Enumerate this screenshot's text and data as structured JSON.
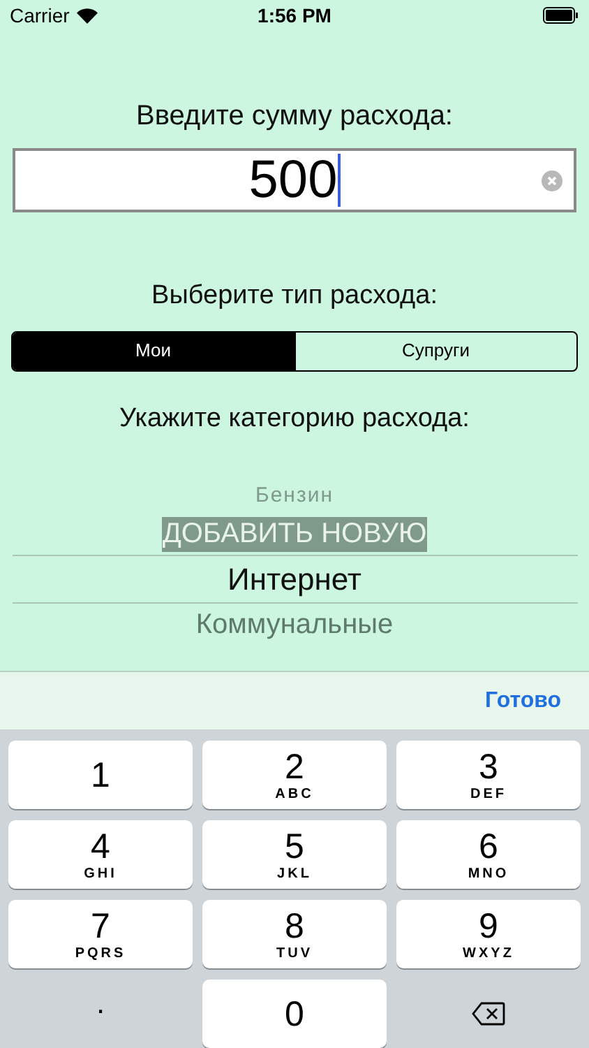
{
  "status_bar": {
    "carrier": "Carrier",
    "time": "1:56 PM"
  },
  "amount": {
    "label": "Введите сумму расхода:",
    "value": "500"
  },
  "type": {
    "label": "Выберите тип расхода:",
    "segments": [
      {
        "label": "Мои",
        "selected": true
      },
      {
        "label": "Супруги",
        "selected": false
      }
    ]
  },
  "category": {
    "label": "Укажите категорию расхода:",
    "items": [
      {
        "label": "Бензин",
        "selected": false,
        "highlighted": false
      },
      {
        "label": "ДОБАВИТЬ НОВУЮ",
        "selected": false,
        "highlighted": true
      },
      {
        "label": "Интернет",
        "selected": true,
        "highlighted": false
      },
      {
        "label": "Коммунальные",
        "selected": false,
        "highlighted": false
      }
    ]
  },
  "toolbar": {
    "done": "Готово"
  },
  "keyboard": {
    "keys": [
      {
        "kind": "digit",
        "digit": "1"
      },
      {
        "kind": "digit",
        "digit": "2",
        "letters": "ABC"
      },
      {
        "kind": "digit",
        "digit": "3",
        "letters": "DEF"
      },
      {
        "kind": "digit",
        "digit": "4",
        "letters": "GHI"
      },
      {
        "kind": "digit",
        "digit": "5",
        "letters": "JKL"
      },
      {
        "kind": "digit",
        "digit": "6",
        "letters": "MNO"
      },
      {
        "kind": "digit",
        "digit": "7",
        "letters": "PQRS"
      },
      {
        "kind": "digit",
        "digit": "8",
        "letters": "TUV"
      },
      {
        "kind": "digit",
        "digit": "9",
        "letters": "WXYZ"
      },
      {
        "kind": "plain",
        "digit": "."
      },
      {
        "kind": "digit",
        "digit": "0"
      },
      {
        "kind": "delete"
      }
    ]
  }
}
